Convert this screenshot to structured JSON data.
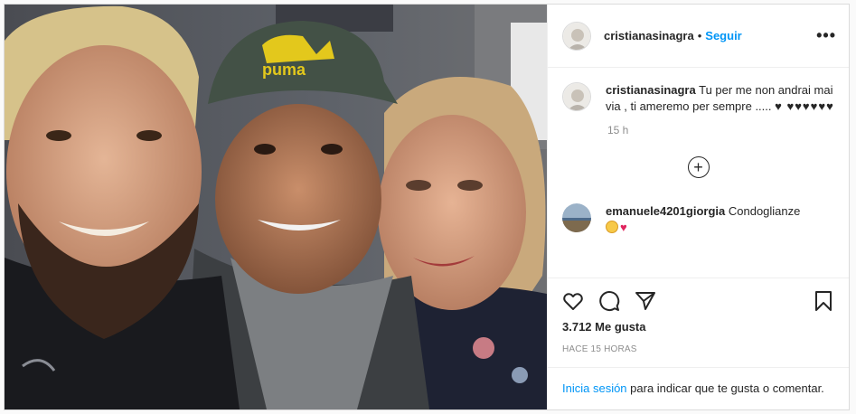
{
  "post": {
    "username": "cristianasinagra",
    "follow_sep": "•",
    "follow_label": "Seguir",
    "more_label": "•••",
    "caption": "Tu per me non andrai mai via , ti ameremo per sempre .....",
    "caption_hearts": "♥ ♥♥♥♥♥♥",
    "time": "15 h",
    "load_more": "+",
    "comment": {
      "username": "emanuele4201giorgia",
      "text": "Condoglianze"
    },
    "likes": "3.712 Me gusta",
    "posted_ago": "HACE 15 HORAS",
    "login_link": "Inicia sesión",
    "login_text": " para indicar que te gusta o comentar.",
    "cap_text_on_photo": "puma"
  },
  "icons": [
    "heart-icon",
    "comment-icon",
    "share-icon",
    "bookmark-icon"
  ],
  "colors": {
    "accent": "#0095f6",
    "muted": "#8e8e8e",
    "border": "#dbdbdb"
  }
}
